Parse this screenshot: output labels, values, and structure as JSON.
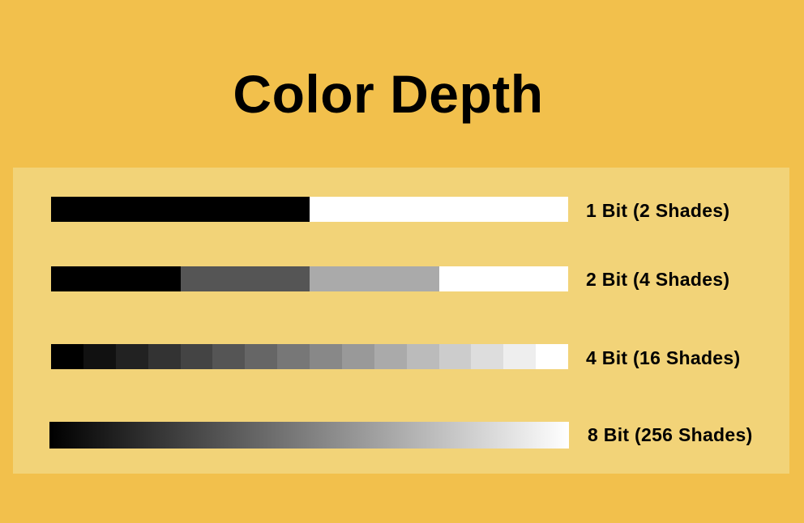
{
  "title": "Color Depth",
  "rows": [
    {
      "label": "1 Bit (2 Shades)",
      "bits": 1,
      "shades": 2
    },
    {
      "label": "2 Bit (4 Shades)",
      "bits": 2,
      "shades": 4
    },
    {
      "label": "4 Bit (16 Shades)",
      "bits": 4,
      "shades": 16
    },
    {
      "label": "8 Bit (256 Shades)",
      "bits": 8,
      "shades": 256
    }
  ],
  "colors": {
    "background": "#f2c04c",
    "panel": "#f2d378",
    "dark": "#000000",
    "light": "#ffffff"
  }
}
